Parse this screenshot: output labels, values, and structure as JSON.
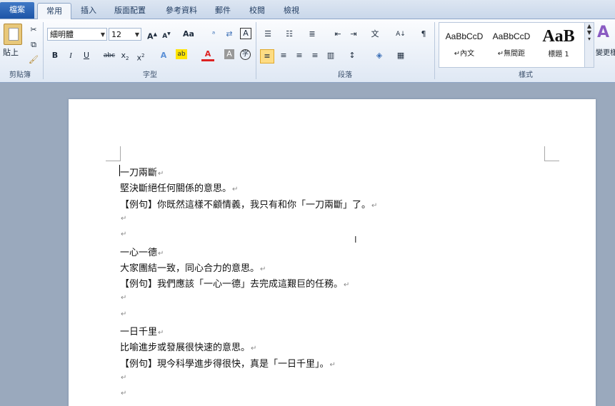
{
  "tabs": {
    "file": "檔案",
    "home": "常用",
    "insert": "插入",
    "layout": "版面配置",
    "references": "參考資料",
    "mailings": "郵件",
    "review": "校閱",
    "view": "檢視"
  },
  "clipboard": {
    "paste_label": "貼上",
    "group_label": "剪貼簿"
  },
  "font": {
    "name": "細明體",
    "size": "12",
    "aa_label": "Aa",
    "group_label": "字型"
  },
  "paragraph": {
    "group_label": "段落"
  },
  "styles": {
    "group_label": "樣式",
    "items": [
      {
        "sample": "AaBbCcD",
        "name": "↵內文"
      },
      {
        "sample": "AaBbCcD",
        "name": "↵無間距"
      },
      {
        "sample": "AaB",
        "name": "標題 1"
      }
    ],
    "change_label": "變更樣"
  },
  "document": {
    "paragraph_mark": "↵",
    "lines": [
      "一刀兩斷",
      "堅決斷絕任何關係的意思。",
      "【例句】你既然這樣不顧情義，我只有和你「一刀兩斷」了。",
      "",
      "",
      "一心一德",
      "大家團結一致，同心合力的意思。",
      "【例句】我們應該「一心一德」去完成這艱巨的任務。",
      "",
      "",
      "一日千里",
      "比喻進步或發展很快速的意思。",
      "【例句】現今科學進步得很快，真是「一日千里」。",
      "",
      ""
    ]
  }
}
